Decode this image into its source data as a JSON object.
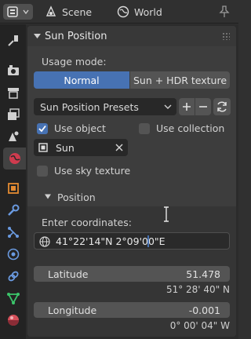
{
  "header": {
    "scene_label": "Scene",
    "world_label": "World"
  },
  "panel": {
    "title": "Sun Position",
    "usage_mode_label": "Usage mode:",
    "modes": [
      "Normal",
      "Sun + HDR texture"
    ],
    "active_mode": "Normal",
    "presets_label": "Sun Position Presets",
    "use_object_label": "Use object",
    "use_object_checked": true,
    "use_collection_label": "Use collection",
    "use_collection_checked": false,
    "object_name": "Sun",
    "use_sky_texture_label": "Use sky texture",
    "use_sky_texture_checked": false,
    "position_label": "Position",
    "enter_coordinates_label": "Enter coordinates:",
    "coordinates_value": "41°22'14\"N 2°09'00\"E",
    "latitude_label": "Latitude",
    "latitude_value": "51.478",
    "latitude_dms": "51° 28' 40\" N",
    "longitude_label": "Longitude",
    "longitude_value": "-0.001",
    "longitude_dms": "0° 00' 04\" W"
  },
  "colors": {
    "accent": "#4772b3",
    "panel_bg": "#3d3d3d",
    "field_dark": "#282828"
  }
}
